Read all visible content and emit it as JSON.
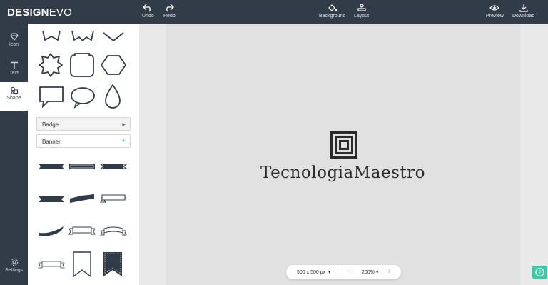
{
  "app": {
    "logo_main": "DESIGN",
    "logo_accent": "EVO"
  },
  "toolbar": {
    "undo": "Undo",
    "redo": "Redo",
    "background": "Background",
    "layout": "Layout",
    "preview": "Preview",
    "download": "Download"
  },
  "rail": {
    "icon": "Icon",
    "text": "Text",
    "shape": "Shape",
    "settings": "Settings"
  },
  "panel": {
    "badge_select": "Badge",
    "banner_select": "Banner"
  },
  "canvas": {
    "brand_text": "TecnologiaMaestro"
  },
  "zoombar": {
    "size": "500 x 500 px",
    "zoom": "200%"
  },
  "colors": {
    "dark": "#323c48",
    "accent": "#3cc9a3",
    "canvas": "#e1e1e1"
  }
}
